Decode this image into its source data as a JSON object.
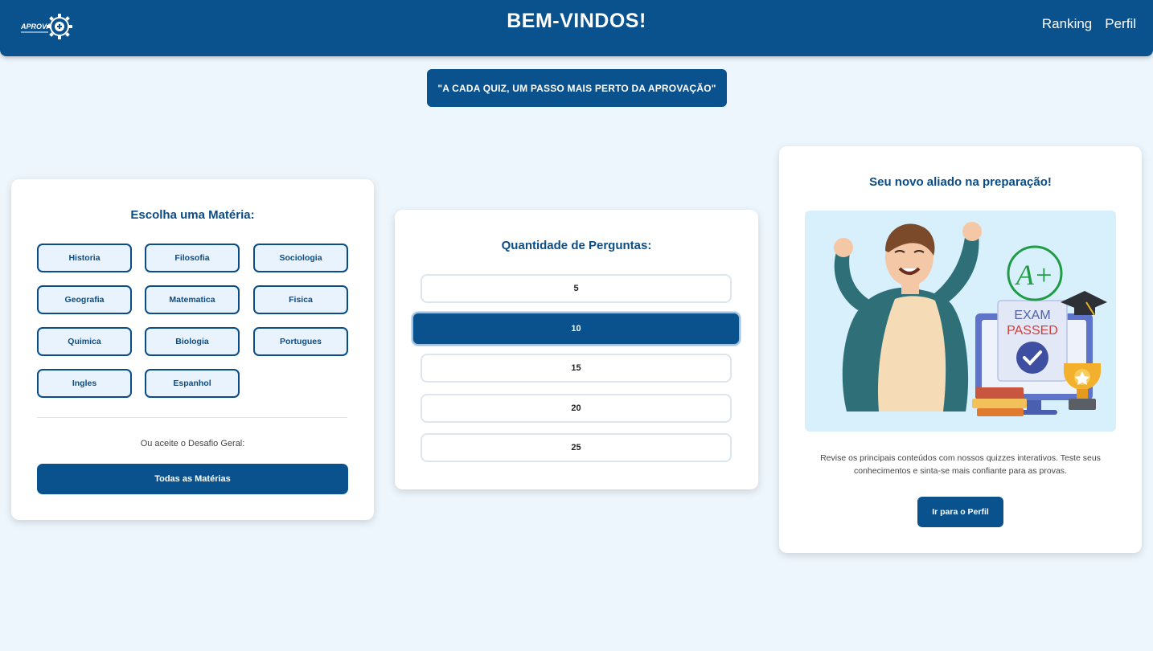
{
  "header": {
    "logo_text": "APROVA",
    "title": "BEM-VINDOS!",
    "nav": [
      {
        "label": "Ranking"
      },
      {
        "label": "Perfil"
      }
    ]
  },
  "motto": "\"A CADA QUIZ, UM PASSO MAIS PERTO DA APROVAÇÃO\"",
  "subjects_card": {
    "title": "Escolha uma Matéria:",
    "subjects": [
      "Historia",
      "Filosofia",
      "Sociologia",
      "Geografia",
      "Matematica",
      "Fisica",
      "Quimica",
      "Biologia",
      "Portugues",
      "Ingles",
      "Espanhol"
    ],
    "challenge_text": "Ou aceite o Desafio Geral:",
    "all_button": "Todas as Matérias"
  },
  "quantity_card": {
    "title": "Quantidade de Perguntas:",
    "options": [
      "5",
      "10",
      "15",
      "20",
      "25"
    ],
    "selected": "10"
  },
  "promo_card": {
    "title": "Seu novo aliado na preparação!",
    "illustration": {
      "grade": "A+",
      "exam_line1": "EXAM",
      "exam_line2": "PASSED"
    },
    "description": "Revise os principais conteúdos com nossos quizzes interativos. Teste seus conhecimentos e sinta-se mais confiante para as provas.",
    "button": "Ir para o Perfil"
  },
  "colors": {
    "primary": "#0a528e",
    "background": "#eef6fd",
    "subject_bg": "#e8f3fd"
  }
}
